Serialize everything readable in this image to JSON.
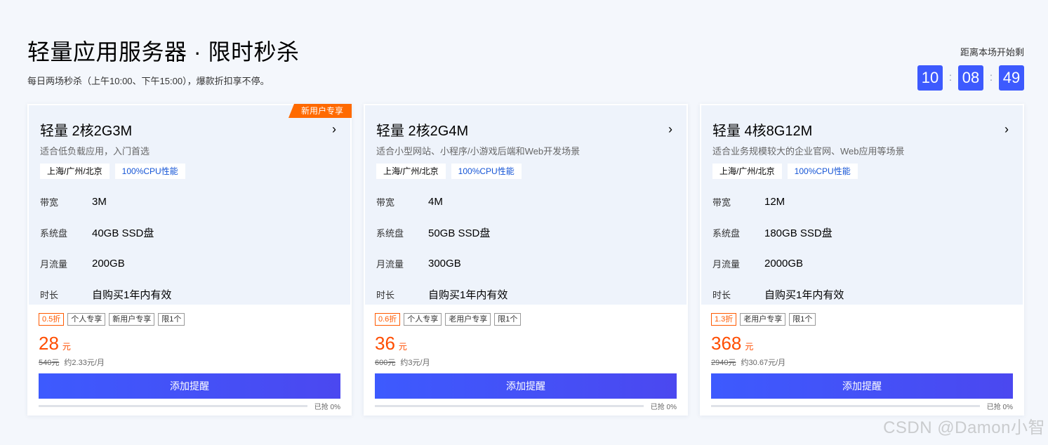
{
  "header": {
    "title": "轻量应用服务器 · 限时秒杀",
    "subtitle": "每日两场秒杀（上午10:00、下午15:00），爆款折扣享不停。"
  },
  "countdown": {
    "label": "距离本场开始剩",
    "hours": "10",
    "minutes": "08",
    "seconds": "49",
    "separator": ":"
  },
  "cards": [
    {
      "ribbon": "新用户专享",
      "title": "轻量 2核2G3M",
      "desc": "适合低负载应用，入门首选",
      "tags": [
        "上海/广州/北京",
        "100%CPU性能"
      ],
      "specs": [
        {
          "label": "带宽",
          "value": "3M"
        },
        {
          "label": "系统盘",
          "value": "40GB SSD盘"
        },
        {
          "label": "月流量",
          "value": "200GB"
        },
        {
          "label": "时长",
          "value": "自购买1年内有效"
        }
      ],
      "badges": [
        "0.5折",
        "个人专享",
        "新用户专享",
        "限1个"
      ],
      "price": "28",
      "price_unit": "元",
      "original_price": "540元",
      "monthly": "约2.33元/月",
      "cta": "添加提醒",
      "sold_text": "已抢 0%",
      "sold_percent": 0
    },
    {
      "ribbon": "",
      "title": "轻量 2核2G4M",
      "desc": "适合小型网站、小程序/小游戏后端和Web开发场景",
      "tags": [
        "上海/广州/北京",
        "100%CPU性能"
      ],
      "specs": [
        {
          "label": "带宽",
          "value": "4M"
        },
        {
          "label": "系统盘",
          "value": "50GB SSD盘"
        },
        {
          "label": "月流量",
          "value": "300GB"
        },
        {
          "label": "时长",
          "value": "自购买1年内有效"
        }
      ],
      "badges": [
        "0.6折",
        "个人专享",
        "老用户专享",
        "限1个"
      ],
      "price": "36",
      "price_unit": "元",
      "original_price": "600元",
      "monthly": "约3元/月",
      "cta": "添加提醒",
      "sold_text": "已抢 0%",
      "sold_percent": 0
    },
    {
      "ribbon": "",
      "title": "轻量 4核8G12M",
      "desc": "适合业务规模较大的企业官网、Web应用等场景",
      "tags": [
        "上海/广州/北京",
        "100%CPU性能"
      ],
      "specs": [
        {
          "label": "带宽",
          "value": "12M"
        },
        {
          "label": "系统盘",
          "value": "180GB SSD盘"
        },
        {
          "label": "月流量",
          "value": "2000GB"
        },
        {
          "label": "时长",
          "value": "自购买1年内有效"
        }
      ],
      "badges": [
        "1.3折",
        "老用户专享",
        "限1个"
      ],
      "price": "368",
      "price_unit": "元",
      "original_price": "2940元",
      "monthly": "约30.67元/月",
      "cta": "添加提醒",
      "sold_text": "已抢 0%",
      "sold_percent": 0
    }
  ],
  "watermark": "CSDN @Damon小智",
  "colors": {
    "accent": "#3d5afe",
    "price": "#ff4d00",
    "ribbon": "#ff6a00"
  }
}
